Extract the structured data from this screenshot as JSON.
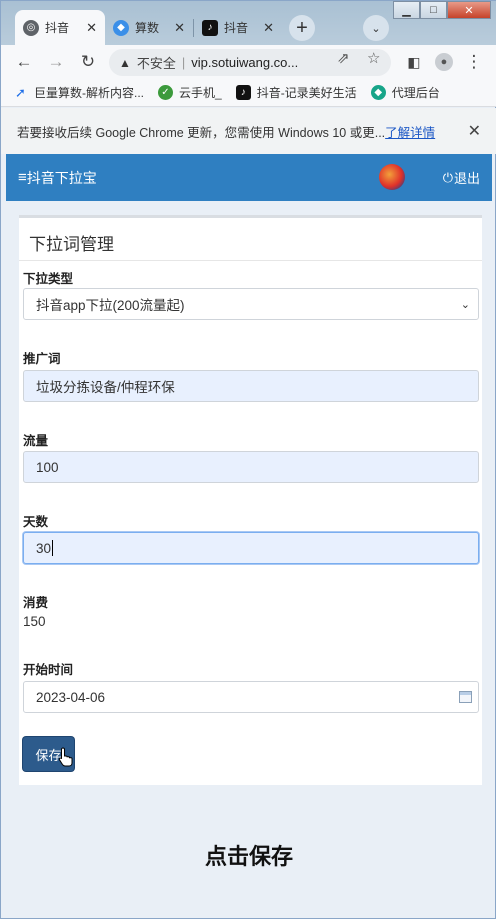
{
  "browser": {
    "tabs": [
      {
        "title": "抖音",
        "active": true
      },
      {
        "title": "算数",
        "active": false
      },
      {
        "title": "抖音",
        "active": false
      }
    ],
    "address": {
      "security_label": "不安全",
      "url": "vip.sotuiwang.co..."
    },
    "bookmarks": [
      {
        "label": "巨量算数-解析内容..."
      },
      {
        "label": "云手机_"
      },
      {
        "label": "抖音-记录美好生活"
      },
      {
        "label": "代理后台"
      }
    ],
    "infobar": {
      "text": "若要接收后续 Google Chrome 更新，您需使用 Windows 10 或更...",
      "link": "了解详情"
    }
  },
  "site": {
    "brand": "抖音下拉宝",
    "logout": "退出",
    "panel_title": "下拉词管理",
    "form": {
      "type_label": "下拉类型",
      "type_value": "抖音app下拉(200流量起)",
      "keyword_label": "推广词",
      "keyword_value": "垃圾分拣设备/仲程环保",
      "traffic_label": "流量",
      "traffic_value": "100",
      "days_label": "天数",
      "days_value": "30",
      "cost_label": "消费",
      "cost_value": "150",
      "start_label": "开始时间",
      "start_value": "2023-04-06",
      "save_label": "保存"
    }
  },
  "caption": "点击保存",
  "colors": {
    "navbar": "#2f7fc1",
    "save_button": "#2d5b8c",
    "infobar_link": "#1a56c5"
  }
}
